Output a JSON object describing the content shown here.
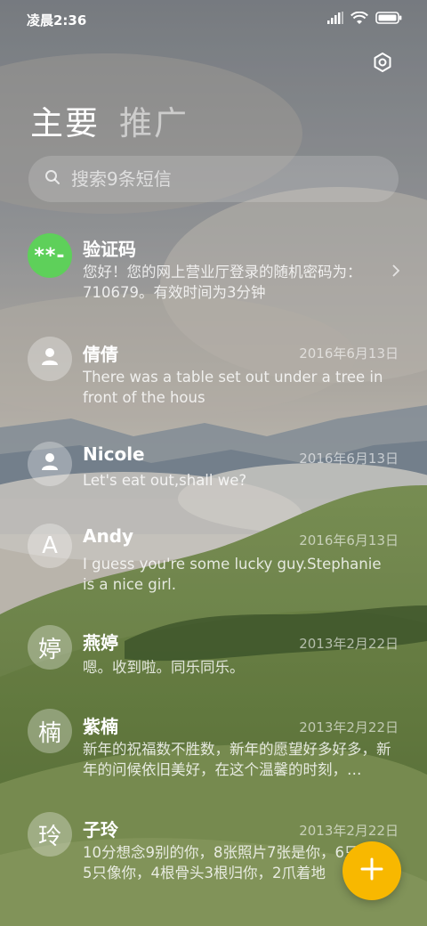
{
  "status_bar": {
    "time": "凌晨2:36"
  },
  "tabs": [
    {
      "label": "主要",
      "active": true
    },
    {
      "label": "推广",
      "active": false
    }
  ],
  "search": {
    "placeholder": "搜索9条短信"
  },
  "messages": [
    {
      "name": "验证码",
      "date": "",
      "preview": "您好！您的网上营业厅登录的随机密码为：710679。有效时间为3分钟",
      "avatar": "**-",
      "avatar_type": "code",
      "has_chevron": true
    },
    {
      "name": "倩倩",
      "date": "2016年6月13日",
      "preview": "There was a table set out under a tree in front of the hous",
      "avatar": "",
      "avatar_type": "person-icon"
    },
    {
      "name": "Nicole",
      "date": "2016年6月13日",
      "preview": "Let's eat out,shall we?",
      "avatar": "",
      "avatar_type": "person-icon"
    },
    {
      "name": "Andy",
      "date": "2016年6月13日",
      "preview": "I guess you're some lucky guy.Stephanie is a nice girl.",
      "avatar": "A",
      "avatar_type": "letter"
    },
    {
      "name": "燕婷",
      "date": "2013年2月22日",
      "preview": "嗯。收到啦。同乐同乐。",
      "avatar": "婷",
      "avatar_type": "letter"
    },
    {
      "name": "紫楠",
      "date": "2013年2月22日",
      "preview": "新年的祝福数不胜数，新年的愿望好多好多，新年的问候依旧美好，在这个温馨的时刻，…",
      "avatar": "楠",
      "avatar_type": "letter"
    },
    {
      "name": "子玲",
      "date": "2013年2月22日",
      "preview": "10分想念9别的你，8张照片7张是你，6只小狗5只像你，4根骨头3根归你，2爪着地",
      "avatar": "玲",
      "avatar_type": "letter"
    }
  ],
  "colors": {
    "accent": "#f8b800",
    "code_avatar": "#5ed05a"
  },
  "icons": {
    "settings": "gear-icon",
    "search": "search-icon",
    "compose": "plus-icon"
  }
}
